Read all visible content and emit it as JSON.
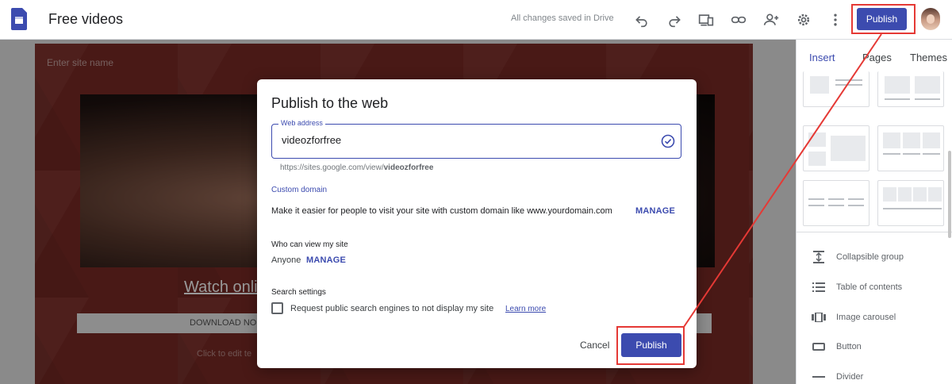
{
  "app": {
    "doc_title": "Free videos",
    "save_status": "All changes saved in Drive",
    "publish_label": "Publish"
  },
  "toolbar_icons": [
    "undo-icon",
    "redo-icon",
    "preview-icon",
    "link-icon",
    "share-icon",
    "settings-icon",
    "more-icon"
  ],
  "canvas": {
    "site_name_placeholder": "Enter site name",
    "watch_text": "Watch onli",
    "download_text": "DOWNLOAD NO",
    "click_edit_text": "Click to edit te"
  },
  "right_panel": {
    "tabs": [
      {
        "label": "Insert",
        "active": true
      },
      {
        "label": "Pages",
        "active": false
      },
      {
        "label": "Themes",
        "active": false
      }
    ],
    "insert_items": [
      {
        "label": "Collapsible group",
        "icon": "collapsible-icon"
      },
      {
        "label": "Table of contents",
        "icon": "toc-icon"
      },
      {
        "label": "Image carousel",
        "icon": "carousel-icon"
      },
      {
        "label": "Button",
        "icon": "button-icon"
      },
      {
        "label": "Divider",
        "icon": "divider-icon"
      }
    ]
  },
  "dialog": {
    "title": "Publish to the web",
    "web_address_label": "Web address",
    "web_address_value": "videozforfree",
    "url_prefix": "https://sites.google.com/view/",
    "url_slug": "videozforfree",
    "custom_domain_label": "Custom domain",
    "custom_domain_text": "Make it easier for people to visit your site with custom domain like www.yourdomain.com",
    "manage_label": "MANAGE",
    "who_can_view_label": "Who can view my site",
    "viewer_value": "Anyone",
    "search_settings_label": "Search settings",
    "search_checkbox_text": "Request public search engines to not display my site",
    "search_checkbox_checked": false,
    "learn_more": "Learn more",
    "cancel_label": "Cancel",
    "publish_label": "Publish"
  },
  "colors": {
    "accent": "#3c4baf",
    "highlight": "#e53935",
    "canvas_bg": "#7b2a25"
  }
}
